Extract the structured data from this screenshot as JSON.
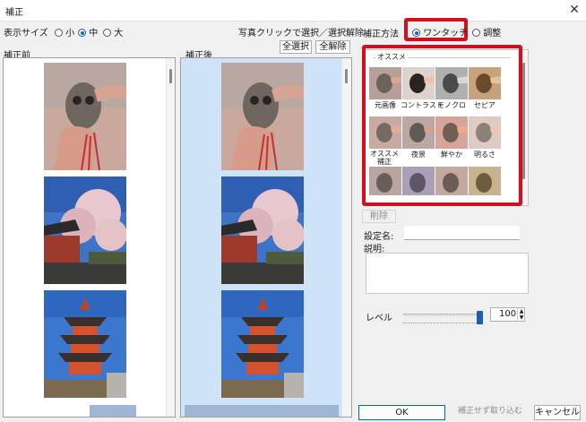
{
  "window": {
    "title": "補正"
  },
  "display_size": {
    "label": "表示サイズ",
    "options": [
      "小",
      "中",
      "大"
    ],
    "selected": "中"
  },
  "photo_hint": "写真クリックで選択／選択解除",
  "select_all_button": "全選択",
  "deselect_all_button": "全解除",
  "before_label": "補正前",
  "after_label": "補正後",
  "method": {
    "label": "補正方法",
    "options": [
      "ワンタッチ",
      "調整"
    ],
    "selected": "ワンタッチ"
  },
  "presets": {
    "group_label": "オススメ",
    "items": [
      "元画像",
      "コントラスト",
      "モノクロ",
      "セピア",
      "オススメ補正",
      "夜景",
      "鮮やか",
      "明るさ",
      "",
      "",
      "",
      ""
    ]
  },
  "delete_button": "削除",
  "setting_name_label": "設定名:",
  "description_label": "説明:",
  "level": {
    "label": "レベル",
    "value": "100",
    "slider_fraction": 1.0
  },
  "ok_button": "OK",
  "import_button": "補正せず取り込む",
  "cancel_button": "キャンセル",
  "colors": {
    "accent": "#1a5fb4",
    "highlight": "#d01020",
    "after_panel": "#cfe3f8"
  }
}
